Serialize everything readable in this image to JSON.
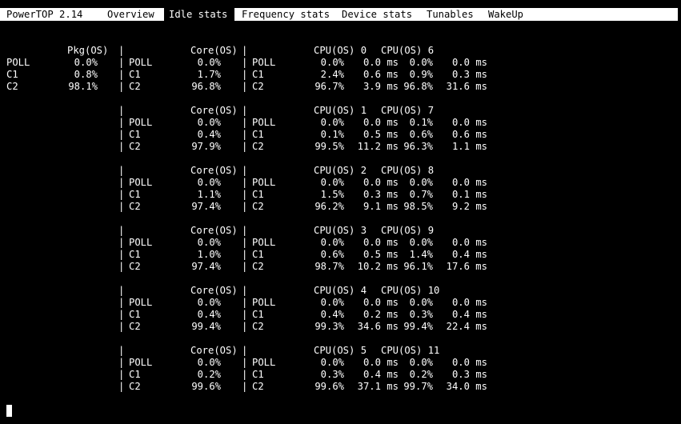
{
  "app": {
    "title": "PowerTOP 2.14"
  },
  "tabs": [
    {
      "label": "Overview",
      "active": false
    },
    {
      "label": "Idle stats",
      "active": true
    },
    {
      "label": "Frequency stats",
      "active": false
    },
    {
      "label": "Device stats",
      "active": false
    },
    {
      "label": "Tunables",
      "active": false
    },
    {
      "label": "WakeUp",
      "active": false
    }
  ],
  "package": {
    "header": "Pkg(OS)",
    "states": [
      {
        "name": "POLL",
        "pct": "0.0%"
      },
      {
        "name": "C1",
        "pct": "0.8%"
      },
      {
        "name": "C2",
        "pct": "98.1%"
      }
    ]
  },
  "separator": "|",
  "core_header": "Core(OS)",
  "cores": [
    {
      "cpu_a": "CPU(OS) 0",
      "cpu_b": "CPU(OS) 6",
      "rows": [
        {
          "name": "POLL",
          "core_pct": "0.0%",
          "a_pct": "0.0%",
          "a_ms": "0.0 ms",
          "b_pct": "0.0%",
          "b_ms": "0.0 ms"
        },
        {
          "name": "C1",
          "core_pct": "1.7%",
          "a_pct": "2.4%",
          "a_ms": "0.6 ms",
          "b_pct": "0.9%",
          "b_ms": "0.3 ms"
        },
        {
          "name": "C2",
          "core_pct": "96.8%",
          "a_pct": "96.7%",
          "a_ms": "3.9 ms",
          "b_pct": "96.8%",
          "b_ms": "31.6 ms"
        }
      ]
    },
    {
      "cpu_a": "CPU(OS) 1",
      "cpu_b": "CPU(OS) 7",
      "rows": [
        {
          "name": "POLL",
          "core_pct": "0.0%",
          "a_pct": "0.0%",
          "a_ms": "0.0 ms",
          "b_pct": "0.1%",
          "b_ms": "0.0 ms"
        },
        {
          "name": "C1",
          "core_pct": "0.4%",
          "a_pct": "0.1%",
          "a_ms": "0.5 ms",
          "b_pct": "0.6%",
          "b_ms": "0.6 ms"
        },
        {
          "name": "C2",
          "core_pct": "97.9%",
          "a_pct": "99.5%",
          "a_ms": "11.2 ms",
          "b_pct": "96.3%",
          "b_ms": "1.1 ms"
        }
      ]
    },
    {
      "cpu_a": "CPU(OS) 2",
      "cpu_b": "CPU(OS) 8",
      "rows": [
        {
          "name": "POLL",
          "core_pct": "0.0%",
          "a_pct": "0.0%",
          "a_ms": "0.0 ms",
          "b_pct": "0.0%",
          "b_ms": "0.0 ms"
        },
        {
          "name": "C1",
          "core_pct": "1.1%",
          "a_pct": "1.5%",
          "a_ms": "0.3 ms",
          "b_pct": "0.7%",
          "b_ms": "0.1 ms"
        },
        {
          "name": "C2",
          "core_pct": "97.4%",
          "a_pct": "96.2%",
          "a_ms": "9.1 ms",
          "b_pct": "98.5%",
          "b_ms": "9.2 ms"
        }
      ]
    },
    {
      "cpu_a": "CPU(OS) 3",
      "cpu_b": "CPU(OS) 9",
      "rows": [
        {
          "name": "POLL",
          "core_pct": "0.0%",
          "a_pct": "0.0%",
          "a_ms": "0.0 ms",
          "b_pct": "0.0%",
          "b_ms": "0.0 ms"
        },
        {
          "name": "C1",
          "core_pct": "1.0%",
          "a_pct": "0.6%",
          "a_ms": "0.5 ms",
          "b_pct": "1.4%",
          "b_ms": "0.4 ms"
        },
        {
          "name": "C2",
          "core_pct": "97.4%",
          "a_pct": "98.7%",
          "a_ms": "10.2 ms",
          "b_pct": "96.1%",
          "b_ms": "17.6 ms"
        }
      ]
    },
    {
      "cpu_a": "CPU(OS) 4",
      "cpu_b": "CPU(OS) 10",
      "rows": [
        {
          "name": "POLL",
          "core_pct": "0.0%",
          "a_pct": "0.0%",
          "a_ms": "0.0 ms",
          "b_pct": "0.0%",
          "b_ms": "0.0 ms"
        },
        {
          "name": "C1",
          "core_pct": "0.4%",
          "a_pct": "0.4%",
          "a_ms": "0.2 ms",
          "b_pct": "0.3%",
          "b_ms": "0.4 ms"
        },
        {
          "name": "C2",
          "core_pct": "99.4%",
          "a_pct": "99.3%",
          "a_ms": "34.6 ms",
          "b_pct": "99.4%",
          "b_ms": "22.4 ms"
        }
      ]
    },
    {
      "cpu_a": "CPU(OS) 5",
      "cpu_b": "CPU(OS) 11",
      "rows": [
        {
          "name": "POLL",
          "core_pct": "0.0%",
          "a_pct": "0.0%",
          "a_ms": "0.0 ms",
          "b_pct": "0.0%",
          "b_ms": "0.0 ms"
        },
        {
          "name": "C1",
          "core_pct": "0.2%",
          "a_pct": "0.3%",
          "a_ms": "0.4 ms",
          "b_pct": "0.2%",
          "b_ms": "0.3 ms"
        },
        {
          "name": "C2",
          "core_pct": "99.6%",
          "a_pct": "99.6%",
          "a_ms": "37.1 ms",
          "b_pct": "99.7%",
          "b_ms": "34.0 ms"
        }
      ]
    }
  ]
}
